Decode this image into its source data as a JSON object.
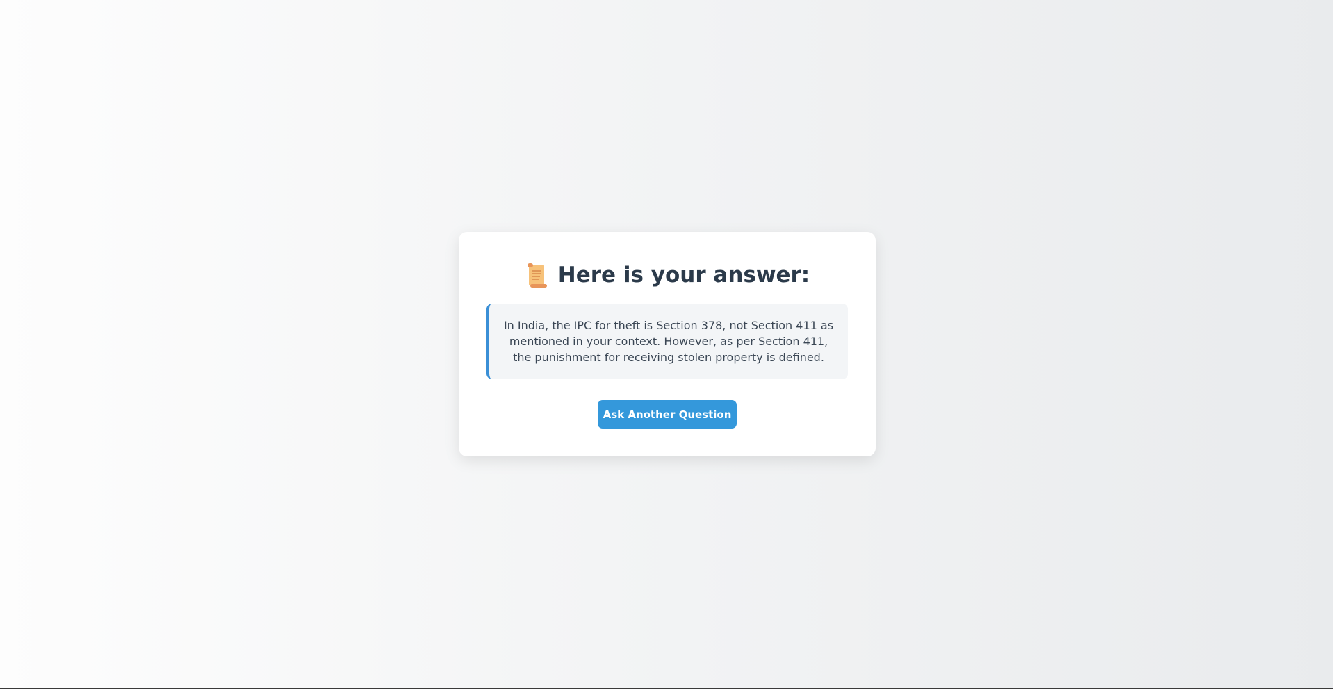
{
  "card": {
    "title": "Here is your answer:",
    "title_icon": "scroll-icon",
    "answer": "In India, the IPC for theft is Section 378, not Section 411 as mentioned in your context. However, as per Section 411, the punishment for receiving stolen property is defined.",
    "button_label": "Ask Another Question"
  },
  "colors": {
    "accent": "#3498db",
    "title_text": "#2b3a4a",
    "answer_border": "#3a8fd6",
    "answer_bg": "#f3f5f7"
  }
}
